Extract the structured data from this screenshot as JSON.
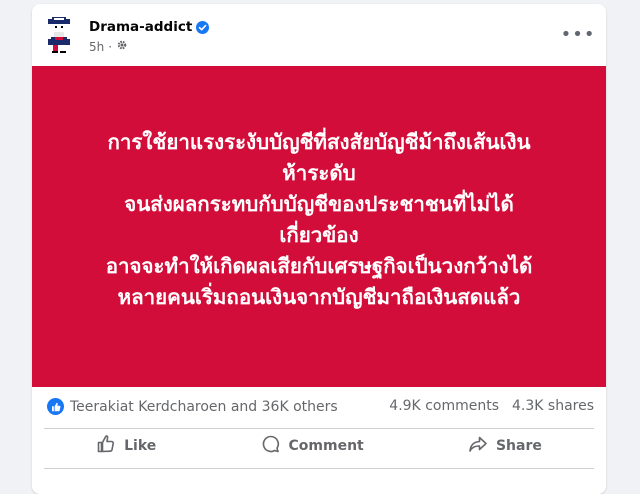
{
  "post": {
    "author": "Drama-addict",
    "time": "5h",
    "banner_lines": [
      "การใช้ยาแรงระงับบัญชีที่สงสัยบัญชีม้าถึงเส้นเงิน",
      "ห้าระดับ",
      "จนส่งผลกระทบกับบัญชีของประชาชนที่ไม่ได้",
      "เกี่ยวข้อง",
      "อาจจะทำให้เกิดผลเสียกับเศรษฐกิจเป็นวงกว้างได้",
      "หลายคนเริ่มถอนเงินจากบัญชีมาถือเงินสดแล้ว"
    ],
    "banner_color": "#d30d3a"
  },
  "stats": {
    "reactions_text": "Teerakiat Kerdcharoen and 36K others",
    "comments": "4.9K comments",
    "shares": "4.3K shares"
  },
  "actions": {
    "like": "Like",
    "comment": "Comment",
    "share": "Share"
  },
  "icons": [
    "verified-badge-icon",
    "globe-gear-icon",
    "more-options-icon",
    "like-reaction-icon",
    "thumbs-up-icon",
    "comment-icon",
    "share-icon"
  ]
}
